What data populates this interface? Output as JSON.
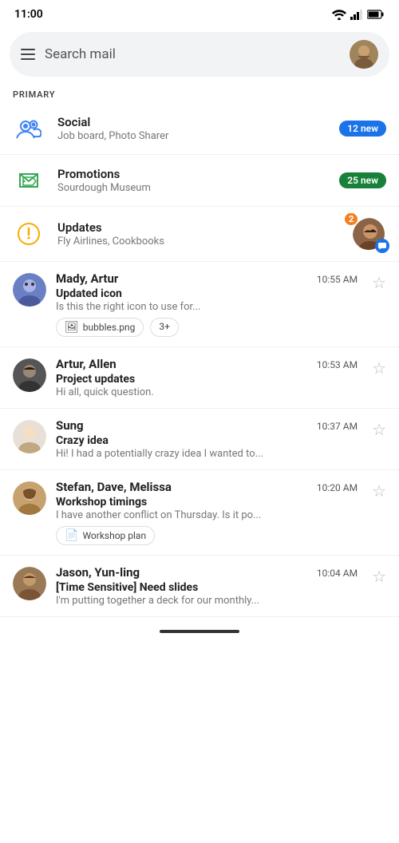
{
  "statusBar": {
    "time": "11:00"
  },
  "searchBar": {
    "placeholder": "Search mail"
  },
  "sectionLabel": "PRIMARY",
  "categories": [
    {
      "id": "social",
      "name": "Social",
      "sub": "Job board, Photo Sharer",
      "badge": "12 new",
      "badgeType": "blue",
      "iconType": "social"
    },
    {
      "id": "promotions",
      "name": "Promotions",
      "sub": "Sourdough Museum",
      "badge": "25 new",
      "badgeType": "green",
      "iconType": "promotions"
    },
    {
      "id": "updates",
      "name": "Updates",
      "sub": "Fly Airlines, Cookbooks",
      "badgeCount": "2",
      "iconType": "updates"
    }
  ],
  "emails": [
    {
      "id": "email1",
      "sender": "Mady, Artur",
      "time": "10:55 AM",
      "subject": "Updated icon",
      "preview": "Is this the right icon to use for...",
      "attachments": [
        "bubbles.png"
      ],
      "moreCount": "3+",
      "avatarColor": "#5c7cfa",
      "avatarInitials": "MA",
      "avatarType": "photo1"
    },
    {
      "id": "email2",
      "sender": "Artur, Allen",
      "time": "10:53 AM",
      "subject": "Project updates",
      "preview": "Hi all, quick question.",
      "attachments": [],
      "avatarColor": "#333",
      "avatarInitials": "AA",
      "avatarType": "photo2"
    },
    {
      "id": "email3",
      "sender": "Sung",
      "time": "10:37 AM",
      "subject": "Crazy idea",
      "preview": "Hi! I had a potentially crazy idea I wanted to...",
      "attachments": [],
      "avatarColor": "#ddd",
      "avatarInitials": "S",
      "avatarType": "photo3"
    },
    {
      "id": "email4",
      "sender": "Stefan, Dave, Melissa",
      "time": "10:20 AM",
      "subject": "Workshop timings",
      "preview": "I have another conflict on Thursday. Is it po...",
      "attachments": [
        "Workshop plan"
      ],
      "attachmentType": "doc",
      "avatarColor": "#c8a26e",
      "avatarInitials": "SD",
      "avatarType": "photo4"
    },
    {
      "id": "email5",
      "sender": "Jason, Yun-ling",
      "time": "10:04 AM",
      "subject": "[Time Sensitive] Need slides",
      "preview": "I'm putting together a deck for our monthly...",
      "attachments": [],
      "avatarColor": "#8B7355",
      "avatarInitials": "JY",
      "avatarType": "photo5"
    }
  ]
}
